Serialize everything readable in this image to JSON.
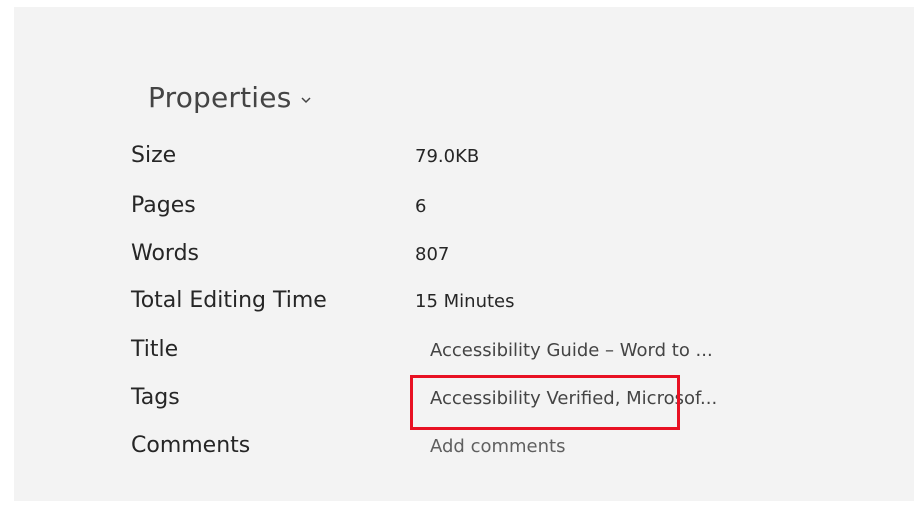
{
  "properties": {
    "title": "Properties",
    "rows": [
      {
        "label": "Size",
        "value": "79.0KB"
      },
      {
        "label": "Pages",
        "value": "6"
      },
      {
        "label": "Words",
        "value": "807"
      },
      {
        "label": "Total Editing Time",
        "value": "15 Minutes"
      },
      {
        "label": "Title",
        "value": "Accessibility Guide – Word to ..."
      },
      {
        "label": "Tags",
        "value": "Accessibility Verified, Microsof..."
      },
      {
        "label": "Comments",
        "value": "Add comments"
      }
    ]
  },
  "colors": {
    "panel_background": "#f3f3f3",
    "highlight_border": "#e81123"
  },
  "icons": {
    "header_chevron": "chevron-down-icon"
  }
}
